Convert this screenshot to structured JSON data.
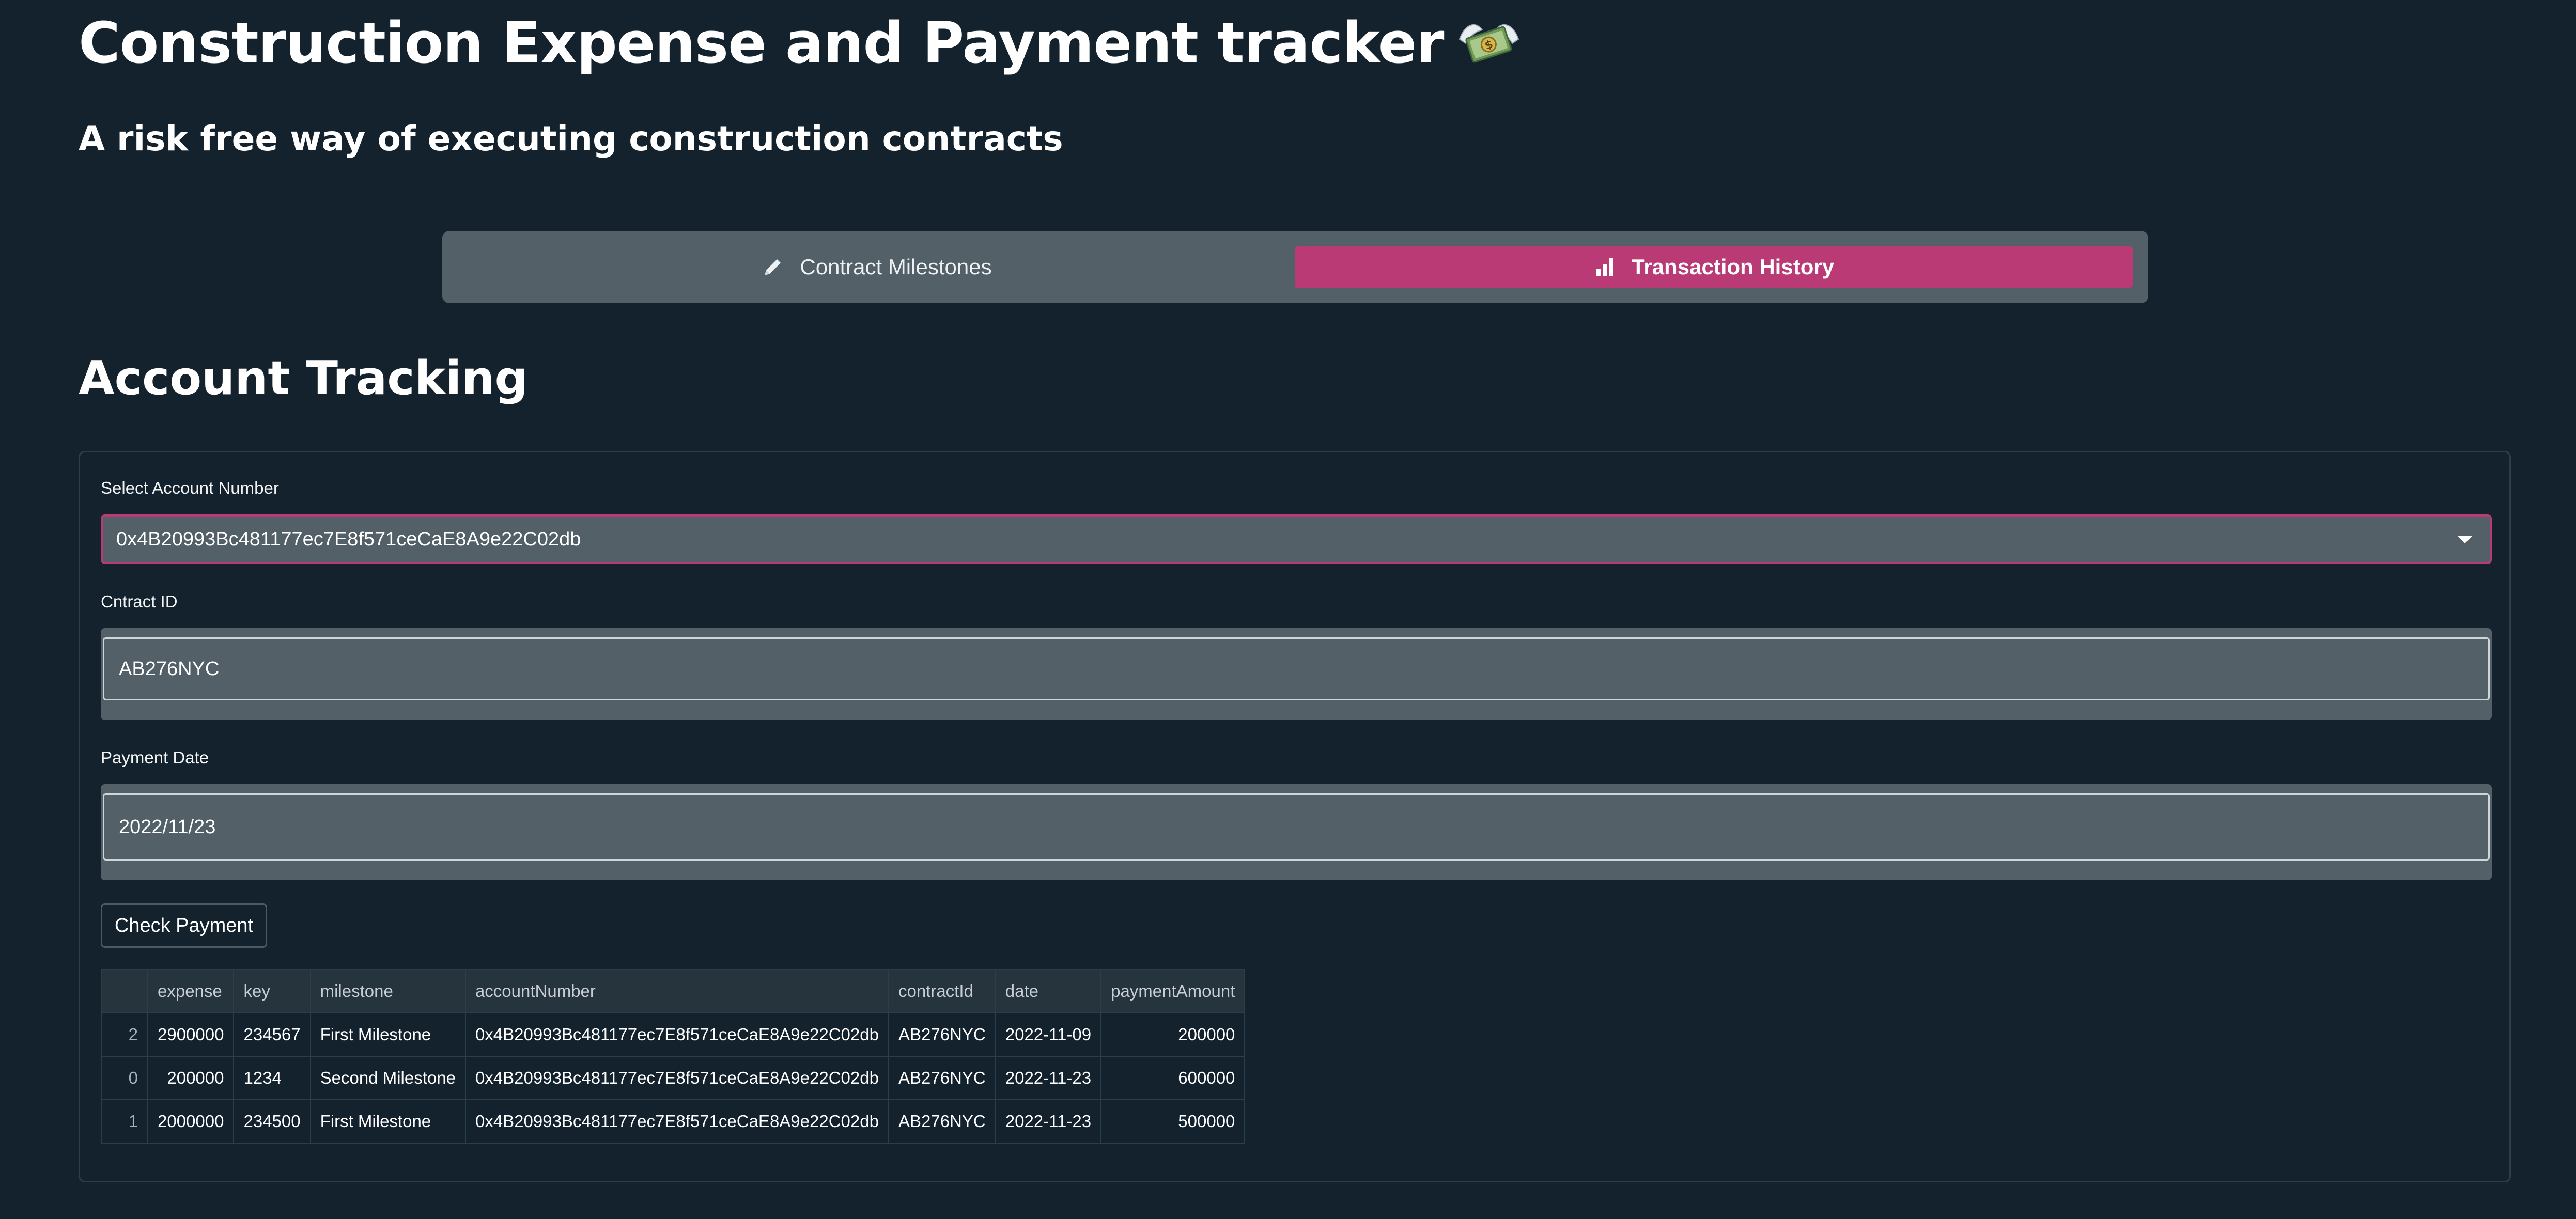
{
  "header": {
    "title": "Construction Expense and Payment tracker",
    "title_icon": "money-with-wings-icon",
    "subtitle": "A risk free way of executing construction contracts"
  },
  "tabs": [
    {
      "label": "Contract Milestones",
      "icon": "pencil-icon",
      "active": false
    },
    {
      "label": "Transaction History",
      "icon": "bar-chart-icon",
      "active": true
    }
  ],
  "section": {
    "heading": "Account Tracking"
  },
  "form": {
    "account_label": "Select Account Number",
    "account_value": "0x4B20993Bc481177ec7E8f571ceCaE8A9e22C02db",
    "contract_label": "Cntract ID",
    "contract_value": "AB276NYC",
    "date_label": "Payment Date",
    "date_value": "2022/11/23",
    "check_button": "Check Payment"
  },
  "table": {
    "columns": [
      "",
      "expense",
      "key",
      "milestone",
      "accountNumber",
      "contractId",
      "date",
      "paymentAmount"
    ],
    "rows": [
      [
        "2",
        "2900000",
        "234567",
        "First Milestone",
        "0x4B20993Bc481177ec7E8f571ceCaE8A9e22C02db",
        "AB276NYC",
        "2022-11-09",
        "200000"
      ],
      [
        "0",
        "200000",
        "1234",
        "Second Milestone",
        "0x4B20993Bc481177ec7E8f571ceCaE8A9e22C02db",
        "AB276NYC",
        "2022-11-23",
        "600000"
      ],
      [
        "1",
        "2000000",
        "234500",
        "First Milestone",
        "0x4B20993Bc481177ec7E8f571ceCaE8A9e22C02db",
        "AB276NYC",
        "2022-11-23",
        "500000"
      ]
    ]
  },
  "colors": {
    "background": "#13222d",
    "accent": "#b93a75",
    "panel_fill": "#536068"
  }
}
